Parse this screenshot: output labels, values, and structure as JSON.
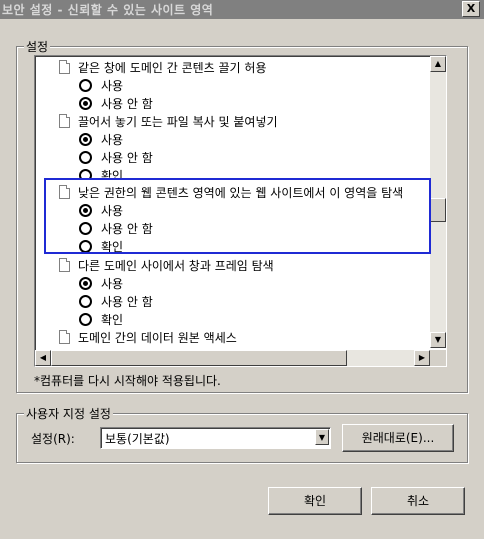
{
  "window": {
    "title": "보안 설정 - 신뢰할 수 있는 사이트 영역",
    "close_label": "X"
  },
  "settings_group": {
    "label": "설정"
  },
  "tree": {
    "items": [
      {
        "label": "같은 창에 도메인 간 콘텐츠 끌기 허용",
        "options": [
          "사용",
          "사용 안 함"
        ],
        "selected": "사용 안 함"
      },
      {
        "label": "끌어서 놓기 또는 파일 복사 및 붙여넣기",
        "options": [
          "사용",
          "사용 안 함",
          "확인"
        ],
        "selected": "사용"
      },
      {
        "label": "낮은 권한의 웹 콘텐츠 영역에 있는 웹 사이트에서 이 영역을 탐색",
        "options": [
          "사용",
          "사용 안 함",
          "확인"
        ],
        "selected": "사용"
      },
      {
        "label": "다른 도메인 사이에서 창과 프레임 탐색",
        "options": [
          "사용",
          "사용 안 함",
          "확인"
        ],
        "selected": "사용"
      },
      {
        "label": "도메인 간의 데이터 원본 액세스",
        "options": [],
        "selected": null
      }
    ]
  },
  "restart_note": "*컴퓨터를 다시 시작해야 적용됩니다.",
  "custom_group": {
    "label": "사용자 지정 설정",
    "setting_label": "설정(R):",
    "select_value": "보통(기본값)",
    "reset_button": "원래대로(E)..."
  },
  "footer": {
    "ok": "확인",
    "cancel": "취소"
  },
  "colors": {
    "highlight": "#1f2ad4",
    "dialog_bg": "#d4d0c8",
    "titlebar": "#808080"
  }
}
